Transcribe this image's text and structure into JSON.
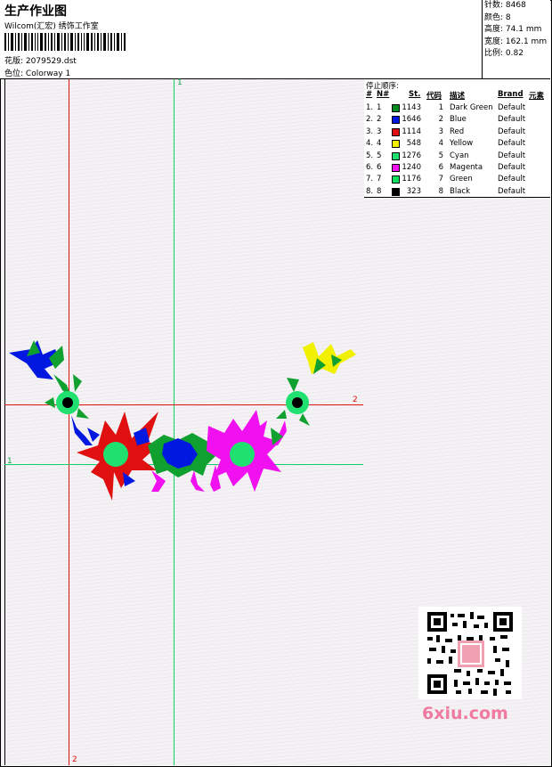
{
  "header": {
    "title": "生产作业图",
    "studio": "Wilcom(汇宏) 绣饰工作室",
    "design_label": "花版:",
    "design_file": "2079529.dst",
    "colorway_label": "色位:",
    "colorway": "Colorway 1"
  },
  "stats": [
    {
      "label": "针数:",
      "value": "8468"
    },
    {
      "label": "颜色:",
      "value": "8"
    },
    {
      "label": "高度:",
      "value": "74.1 mm"
    },
    {
      "label": "宽度:",
      "value": "162.1 mm"
    },
    {
      "label": "比例:",
      "value": "0.82"
    }
  ],
  "stop_table": {
    "caption": "停止顺序:",
    "headers": {
      "index": "#",
      "no": "N#",
      "stitches": "St.",
      "code": "代码",
      "desc": "描述",
      "brand": "Brand",
      "element": "元素"
    },
    "rows": [
      {
        "index": "1.",
        "no": "1",
        "color": "#008a1e",
        "stitches": "1143",
        "code": "1",
        "desc": "Dark Green",
        "brand": "Default"
      },
      {
        "index": "2.",
        "no": "2",
        "color": "#0018e0",
        "stitches": "1646",
        "code": "2",
        "desc": "Blue",
        "brand": "Default"
      },
      {
        "index": "3.",
        "no": "3",
        "color": "#e01010",
        "stitches": "1114",
        "code": "3",
        "desc": "Red",
        "brand": "Default"
      },
      {
        "index": "4.",
        "no": "4",
        "color": "#f0f000",
        "stitches": "548",
        "code": "4",
        "desc": "Yellow",
        "brand": "Default"
      },
      {
        "index": "5.",
        "no": "5",
        "color": "#20e070",
        "stitches": "1276",
        "code": "5",
        "desc": "Cyan",
        "brand": "Default"
      },
      {
        "index": "6.",
        "no": "6",
        "color": "#f010f0",
        "stitches": "1240",
        "code": "6",
        "desc": "Magenta",
        "brand": "Default"
      },
      {
        "index": "7.",
        "no": "7",
        "color": "#10e060",
        "stitches": "1176",
        "code": "7",
        "desc": "Green",
        "brand": "Default"
      },
      {
        "index": "8.",
        "no": "8",
        "color": "#000000",
        "stitches": "323",
        "code": "8",
        "desc": "Black",
        "brand": "Default"
      }
    ]
  },
  "guides": {
    "top": "1",
    "right": "2",
    "left": "1",
    "bottom": "2"
  },
  "watermark": "6xiu.com"
}
